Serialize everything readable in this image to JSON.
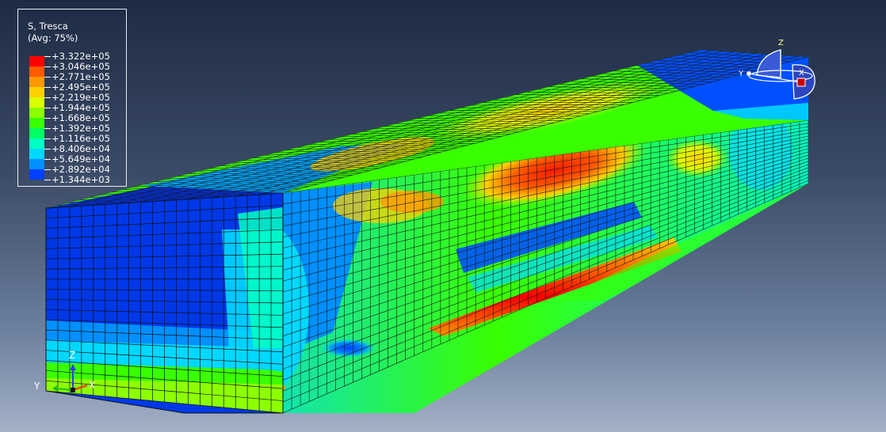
{
  "legend": {
    "title": "S, Tresca",
    "subtitle": "(Avg: 75%)",
    "values": [
      "+3.322e+05",
      "+3.046e+05",
      "+2.771e+05",
      "+2.495e+05",
      "+2.219e+05",
      "+1.944e+05",
      "+1.668e+05",
      "+1.392e+05",
      "+1.116e+05",
      "+8.406e+04",
      "+5.649e+04",
      "+2.892e+04",
      "+1.344e+03"
    ],
    "colors": [
      "#ff0000",
      "#ff5a00",
      "#ff9800",
      "#ffd000",
      "#d8ff00",
      "#8cff00",
      "#39ff00",
      "#00ff60",
      "#00ffc2",
      "#00d8ff",
      "#0090ff",
      "#0040ff",
      "#0000e6"
    ]
  },
  "triad_bottom": {
    "z": "Z",
    "y": "Y",
    "x": "X"
  },
  "triad_top": {
    "z": "Z",
    "y": "Y",
    "x": "X"
  }
}
